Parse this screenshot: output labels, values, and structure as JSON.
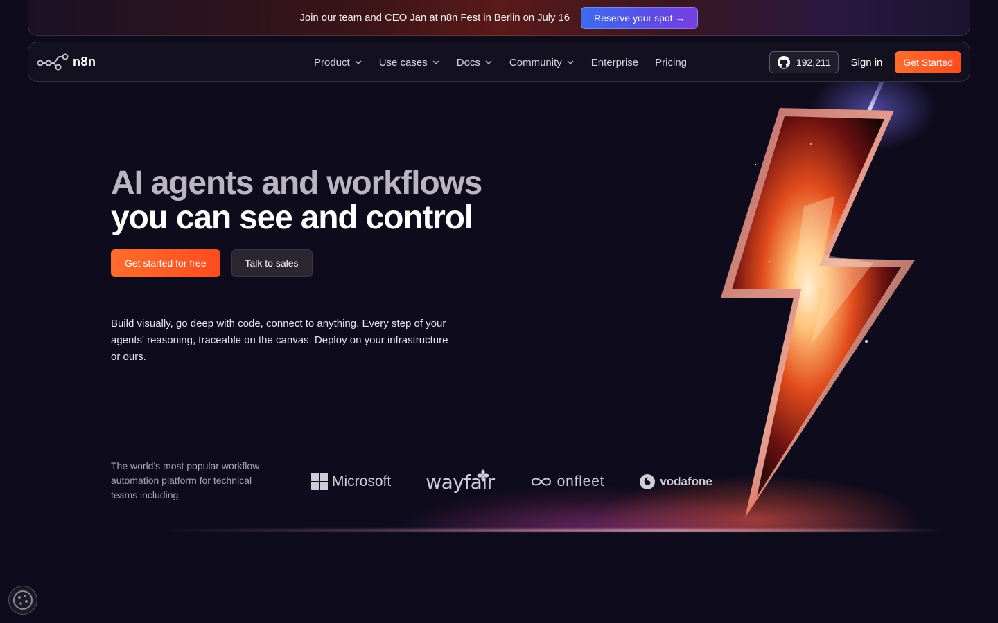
{
  "banner": {
    "text": "Join our team and CEO Jan at n8n Fest in Berlin on July 16",
    "cta": "Reserve your spot →"
  },
  "nav": {
    "logo_text": "n8n",
    "items": [
      {
        "label": "Product",
        "has_dropdown": true
      },
      {
        "label": "Use cases",
        "has_dropdown": true
      },
      {
        "label": "Docs",
        "has_dropdown": true
      },
      {
        "label": "Community",
        "has_dropdown": true
      },
      {
        "label": "Enterprise",
        "has_dropdown": false
      },
      {
        "label": "Pricing",
        "has_dropdown": false
      }
    ],
    "github_stars": "192,211",
    "sign_in": "Sign in",
    "get_started": "Get Started"
  },
  "hero": {
    "title_line1": "AI agents and workflows",
    "title_line2": "you can see and control",
    "primary_cta": "Get started for free",
    "secondary_cta": "Talk to sales",
    "description": "Build visually, go deep with code, connect to anything. Every step of your agents' reasoning, traceable on the canvas. Deploy on your infrastructure or ours."
  },
  "social_proof": {
    "text": "The world's most popular workflow automation platform for technical teams including",
    "logos": [
      {
        "name": "Microsoft",
        "icon": "microsoft-logo"
      },
      {
        "name": "wayfair",
        "icon": "wayfair-logo"
      },
      {
        "name": "onfleet",
        "icon": "onfleet-logo"
      },
      {
        "name": "vodafone",
        "icon": "vodafone-logo"
      }
    ]
  },
  "colors": {
    "background": "#0e0b1c",
    "accent_orange": "#ff5c2a",
    "banner_button": "#4f5ceb"
  },
  "icons": {
    "github": "github-icon",
    "chevron": "chevron-down-icon",
    "cookie": "cookie-icon"
  }
}
